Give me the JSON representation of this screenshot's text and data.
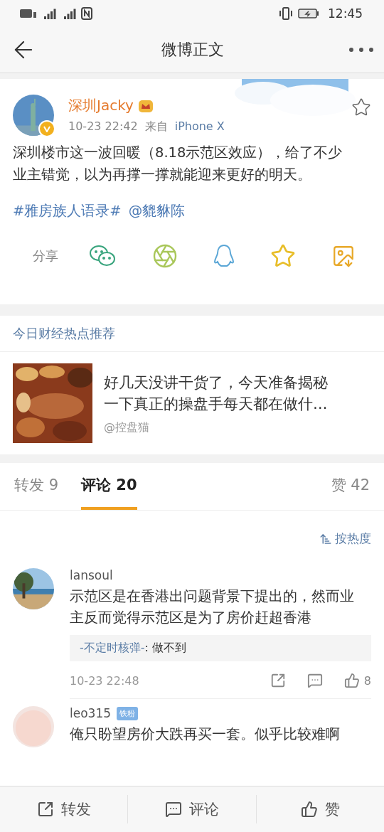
{
  "status_bar": {
    "time": "12:45"
  },
  "header": {
    "title": "微博正文"
  },
  "post": {
    "author": "深圳Jacky",
    "vip": true,
    "verified": true,
    "favorited": false,
    "time": "10-23 22:42",
    "source_prefix": "来自",
    "source": "iPhone X",
    "text": "深圳楼市这一波回暖（8.18示范区效应），给了不少业主错觉，以为再撑一撑就能迎来更好的明天。",
    "tags": [
      "#雅房族人语录#",
      "@貔貅陈"
    ],
    "share_label": "分享",
    "share_targets": [
      {
        "kind": "wechat"
      },
      {
        "kind": "moments"
      },
      {
        "kind": "qq"
      },
      {
        "kind": "favorite"
      },
      {
        "kind": "save-image"
      }
    ]
  },
  "recommendation": {
    "heading": "今日财经热点推荐",
    "items": [
      {
        "text": "好几天没讲干货了，今天准备揭秘一下真正的操盘手每天都在做什…",
        "author": "@控盘猫"
      }
    ]
  },
  "tabs": [
    {
      "label": "转发 9",
      "selected": false
    },
    {
      "label": "评论 20",
      "selected": true
    },
    {
      "label": "赞 42",
      "selected": false
    }
  ],
  "sort": {
    "label": "按热度"
  },
  "comments": [
    {
      "user": "lansoul",
      "text": "示范区是在香港出问题背景下提出的，然而业主反而觉得示范区是为了房价赶超香港",
      "reply": {
        "user": "-不定时核弹-",
        "text": ": 做不到"
      },
      "time": "10-23 22:48",
      "likes": "8"
    },
    {
      "user": "leo315",
      "badge": "铁粉",
      "text": "俺只盼望房价大跌再买一套。似乎比较难啊"
    }
  ],
  "bottom_bar": [
    {
      "kind": "repost",
      "label": "转发"
    },
    {
      "kind": "comment",
      "label": "评论"
    },
    {
      "kind": "like",
      "label": "赞"
    }
  ]
}
